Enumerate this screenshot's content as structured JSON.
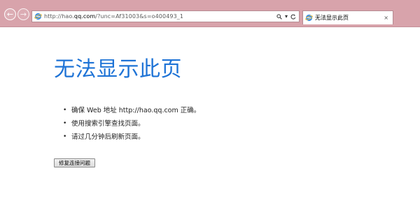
{
  "browser": {
    "back_icon": "back-arrow-icon",
    "forward_icon": "forward-arrow-icon",
    "address": {
      "url_prefix": "http://hao.",
      "url_domain": "qq.com",
      "url_suffix": "/?unc=Af31003&s=o400493_1",
      "search_icon": "search-icon",
      "dropdown_icon": "chevron-down-icon",
      "refresh_icon": "refresh-icon"
    },
    "tab": {
      "label": "无法显示此页",
      "close": "×"
    },
    "colors": {
      "chrome": "#d8a3ab",
      "title_blue": "#1e73d6"
    }
  },
  "page": {
    "title": "无法显示此页",
    "suggestions": [
      "确保 Web 地址 http://hao.qq.com 正确。",
      "使用搜索引擎查找页面。",
      "请过几分钟后刷新页面。"
    ],
    "fix_button_label": "修复连接问题"
  }
}
